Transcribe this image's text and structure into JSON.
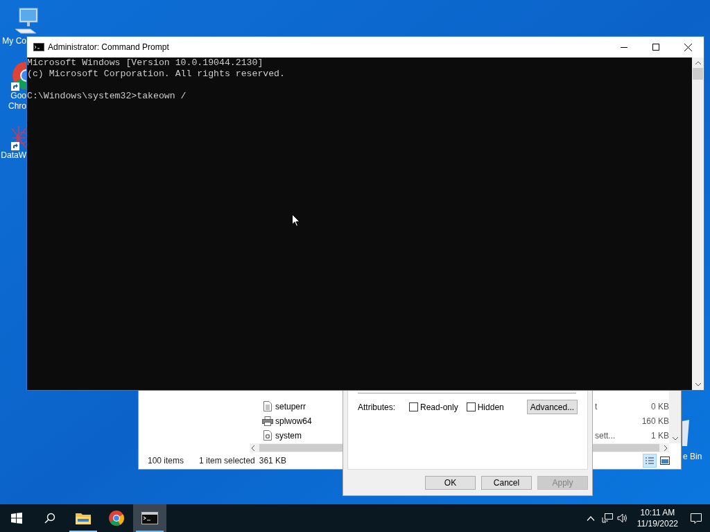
{
  "desktop_icons": [
    {
      "kind": "computer",
      "shortcut": false,
      "lines": [
        "My Co"
      ]
    },
    {
      "kind": "chrome",
      "shortcut": true,
      "lines": [
        "Goo",
        "Chro"
      ]
    },
    {
      "kind": "datawin",
      "shortcut": true,
      "lines": [
        "DataW"
      ]
    }
  ],
  "recycle_bin": {
    "label": "e Bin"
  },
  "explorer": {
    "files": [
      {
        "kind": "document",
        "name": "setuperr",
        "type": "t",
        "size": "0 KB"
      },
      {
        "kind": "printer",
        "name": "splwow64",
        "size": "160 KB"
      },
      {
        "kind": "settings",
        "name": "system",
        "type": "sett...",
        "size": "1 KB"
      }
    ],
    "status": {
      "items": "100 items",
      "selected": "1 item selected",
      "size": "361 KB"
    },
    "views": [
      {
        "kind": "details",
        "selected": true
      },
      {
        "kind": "large",
        "selected": false
      }
    ]
  },
  "properties_dialog": {
    "attributes_label": "Attributes:",
    "checkboxes": [
      {
        "label": "Read-only",
        "checked": false
      },
      {
        "label": "Hidden",
        "checked": false
      }
    ],
    "advanced": "Advanced...",
    "buttons": [
      {
        "label": "OK",
        "disabled": false
      },
      {
        "label": "Cancel",
        "disabled": false
      },
      {
        "label": "Apply",
        "disabled": true
      }
    ]
  },
  "cmd_window": {
    "title": "Administrator: Command Prompt",
    "output": [
      "Microsoft Windows [Version 10.0.19044.2130]",
      "(c) Microsoft Corporation. All rights reserved."
    ],
    "prompt": "C:\\Windows\\system32>takeown /"
  },
  "taskbar": {
    "apps": [
      {
        "kind": "explorer",
        "running": true,
        "selected": false
      },
      {
        "kind": "chrome",
        "running": false,
        "selected": false
      },
      {
        "kind": "cmd",
        "running": true,
        "selected": true
      }
    ],
    "time": "10:11 AM",
    "date": "11/19/2022"
  }
}
